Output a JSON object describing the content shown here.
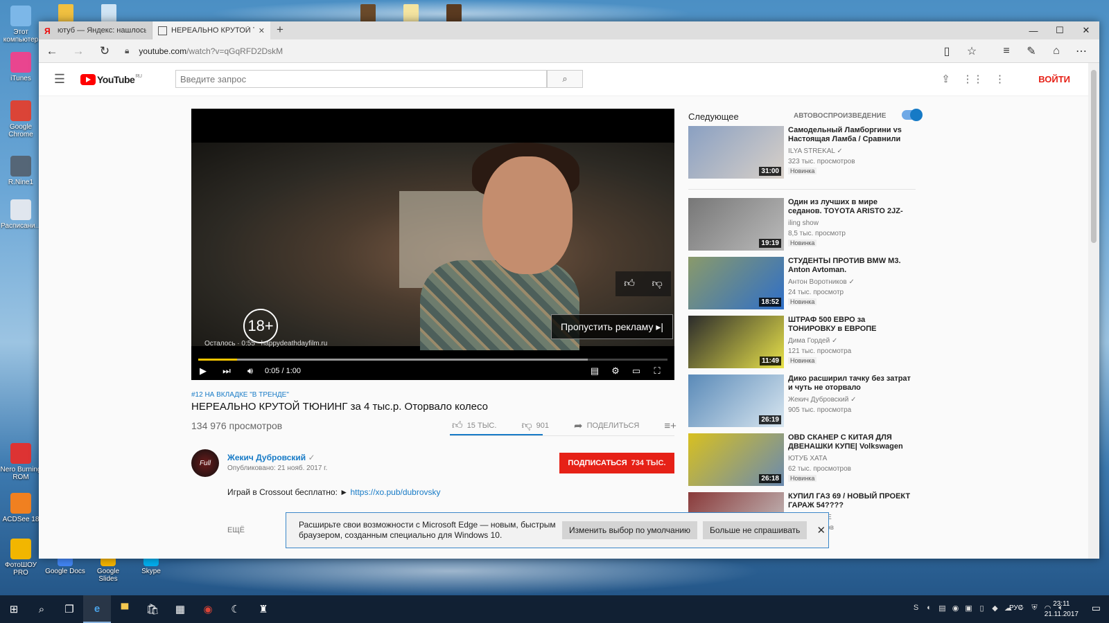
{
  "desktop": {
    "left_icons": [
      {
        "label": "Этот компьютер",
        "color": "#7cb7e8"
      },
      {
        "label": "iTunes",
        "color": "#e9458f"
      },
      {
        "label": "Google Chrome",
        "color": "#db4437"
      },
      {
        "label": "R.Nine1",
        "color": "#556677"
      },
      {
        "label": "Расписани...",
        "color": "#e0e6ee"
      },
      {
        "label": "Nero Burning ROM",
        "color": "#d33"
      },
      {
        "label": "ACDSee 18",
        "color": "#f08020"
      },
      {
        "label": "ФотоШОУ PRO",
        "color": "#f2b600"
      }
    ],
    "bottom_icons": [
      {
        "label": "Google Docs",
        "color": "#4285f4"
      },
      {
        "label": "Google Slides",
        "color": "#f4b400"
      },
      {
        "label": "Skype",
        "color": "#00aff0"
      }
    ]
  },
  "browser": {
    "tabs": [
      {
        "label": "ютуб — Яндекс: нашлось б",
        "active": false,
        "icon": "yandex-icon"
      },
      {
        "label": "НЕРЕАЛЬНО КРУТОЙ Т",
        "active": true,
        "icon": "page-icon"
      }
    ],
    "new_tab": "+",
    "window_controls": {
      "minimize": "—",
      "maximize": "☐",
      "close": "✕"
    },
    "url": {
      "host": "youtube.com",
      "path": "/watch?v=qGqRFD2DskM"
    }
  },
  "youtube": {
    "logo_text": "YouTube",
    "logo_region": "RU",
    "search_placeholder": "Введите запрос",
    "login_label": "ВОЙТИ",
    "player": {
      "age_badge": "18+",
      "remaining": "Осталось · 0:55",
      "ad_link": "happydeathdayfilm.ru",
      "skip_label": "Пропустить рекламу ▸|",
      "time": "0:05 / 1:00",
      "progress": 0.083,
      "buffered": 0.83
    },
    "video": {
      "trending": "#12 НА ВКЛАДКЕ \"В ТРЕНДЕ\"",
      "title": "НЕРЕАЛЬНО КРУТОЙ ТЮНИНГ за 4 тыс.р. Оторвало колесо",
      "views": "134 976 просмотров",
      "likes": "15 ТЫС.",
      "dislikes": "901",
      "share": "ПОДЕЛИТЬСЯ",
      "like_ratio": 0.94
    },
    "channel": {
      "avatar_text": "Full",
      "name": "Жекич Дубровский",
      "published": "Опубликовано: 21 нояб. 2017 г.",
      "subscribe_label": "ПОДПИСАТЬСЯ",
      "subscribers": "734 ТЫС."
    },
    "description": {
      "text": "Играй в Crossout бесплатно: ► ",
      "link": "https://xo.pub/dubrovsky"
    },
    "more_label": "ЕЩЁ",
    "sidebar": {
      "up_next": "Следующее",
      "autoplay": "АВТОВОСПРОИЗВЕДЕНИЕ",
      "items": [
        {
          "title": "Самодельный Ламборгини vs Настоящая Ламба / Сравнили",
          "channel": "ILYA STREKAL ✓",
          "views": "323 тыс. просмотров",
          "badge": "Новинка",
          "duration": "31:00",
          "colors": [
            "#8aa0c2",
            "#d8d0c8"
          ]
        },
        {
          "title": "Один из лучших в мире седанов. TOYOTA ARISTO 2JZ-",
          "channel": "iling show",
          "views": "8,5 тыс. просмотр",
          "badge": "Новинка",
          "duration": "19:19",
          "colors": [
            "#777",
            "#bbb"
          ]
        },
        {
          "title": "СТУДЕНТЫ ПРОТИВ BMW M3. Anton Avtoman.",
          "channel": "Антон Воротников ✓",
          "views": "24 тыс. просмотр",
          "badge": "Новинка",
          "duration": "18:52",
          "colors": [
            "#8a9a6a",
            "#2f6fc8"
          ]
        },
        {
          "title": "ШТРАФ 500 ЕВРО за ТОНИРОВКУ в ЕВРОПЕ",
          "channel": "Дима Гордей ✓",
          "views": "121 тыс. просмотра",
          "badge": "Новинка",
          "duration": "11:49",
          "colors": [
            "#2b2b2b",
            "#e8e24a"
          ]
        },
        {
          "title": "Дико расширил тачку без затрат и чуть не оторвало",
          "channel": "Жекич Дубровский ✓",
          "views": "905 тыс. просмотра",
          "badge": "",
          "duration": "26:19",
          "colors": [
            "#5a8ab8",
            "#d8e6f0"
          ]
        },
        {
          "title": "OBD СКАНЕР С КИТАЯ ДЛЯ ДВЕНАШКИ КУПЕ| Volkswagen",
          "channel": "ЮТУБ ХАТА",
          "views": "62 тыс. просмотров",
          "badge": "Новинка",
          "duration": "26:18",
          "colors": [
            "#d8c020",
            "#6a8ab0"
          ]
        },
        {
          "title": "КУПИЛ ГАЗ 69 / НОВЫЙ ПРОЕКТ ГАРАЖ 54????",
          "channel": "ГАРАЖ 54 FE",
          "views": "... просмотров",
          "badge": "",
          "duration": "",
          "colors": [
            "#8a3a3a",
            "#c8c8c8"
          ]
        }
      ]
    }
  },
  "edge_banner": {
    "text": "Расширьте свои возможности с Microsoft Edge — новым, быстрым браузером, созданным специально для Windows 10.",
    "btn_change": "Изменить выбор по умолчанию",
    "btn_never": "Больше не спрашивать"
  },
  "taskbar": {
    "lang": "РУС",
    "time": "23:11",
    "date": "21.11.2017"
  }
}
